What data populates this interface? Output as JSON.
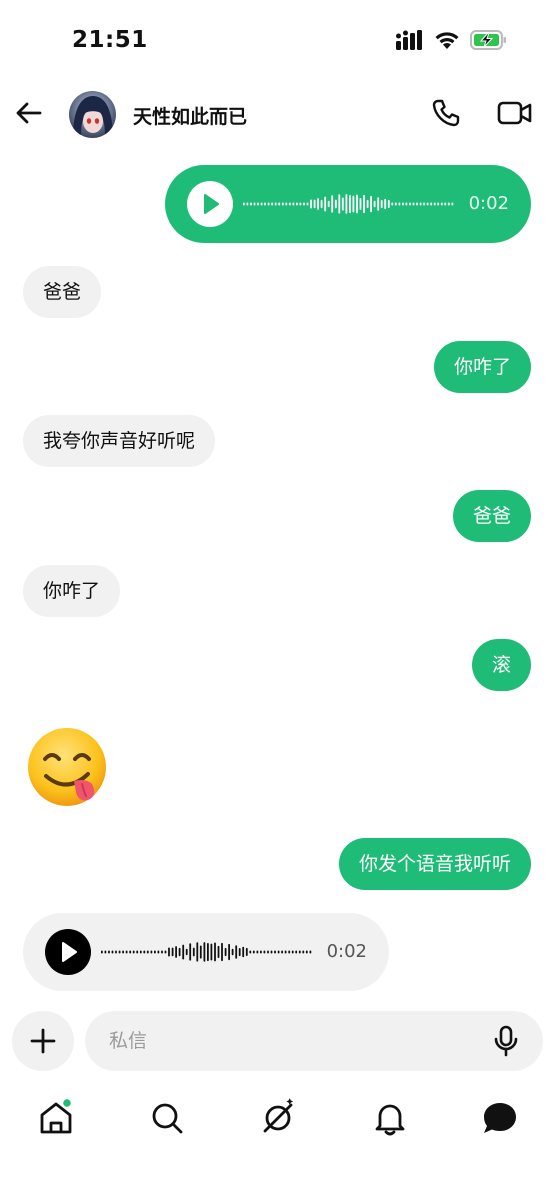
{
  "status_bar": {
    "time": "21:51",
    "battery_color": "#2fc44e"
  },
  "header": {
    "contact_name": "天性如此而已",
    "back_icon": "arrow-left-icon",
    "call_icon": "phone-icon",
    "video_icon": "video-camera-icon"
  },
  "colors": {
    "accent": "#1fbc77",
    "incoming_bubble": "#f1f1f1"
  },
  "messages": [
    {
      "direction": "out",
      "type": "voice",
      "duration": "0:02"
    },
    {
      "direction": "in",
      "type": "text",
      "text": "爸爸"
    },
    {
      "direction": "out",
      "type": "text",
      "text": "你咋了"
    },
    {
      "direction": "in",
      "type": "text",
      "text": "我夸你声音好听呢"
    },
    {
      "direction": "out",
      "type": "text",
      "text": "爸爸"
    },
    {
      "direction": "in",
      "type": "text",
      "text": "你咋了"
    },
    {
      "direction": "out",
      "type": "text",
      "text": "滚"
    },
    {
      "direction": "in",
      "type": "emoji",
      "emoji": "face-savoring-food-emoji"
    },
    {
      "direction": "out",
      "type": "text",
      "text": "你发个语音我听听"
    },
    {
      "direction": "in",
      "type": "voice",
      "duration": "0:02"
    }
  ],
  "composer": {
    "placeholder": "私信",
    "plus_icon": "plus-icon",
    "mic_icon": "microphone-icon"
  },
  "bottom_nav": {
    "items": [
      "home-icon",
      "search-icon",
      "explore-icon",
      "bell-icon",
      "messages-icon"
    ],
    "home_badge_color": "#1fbc77"
  }
}
